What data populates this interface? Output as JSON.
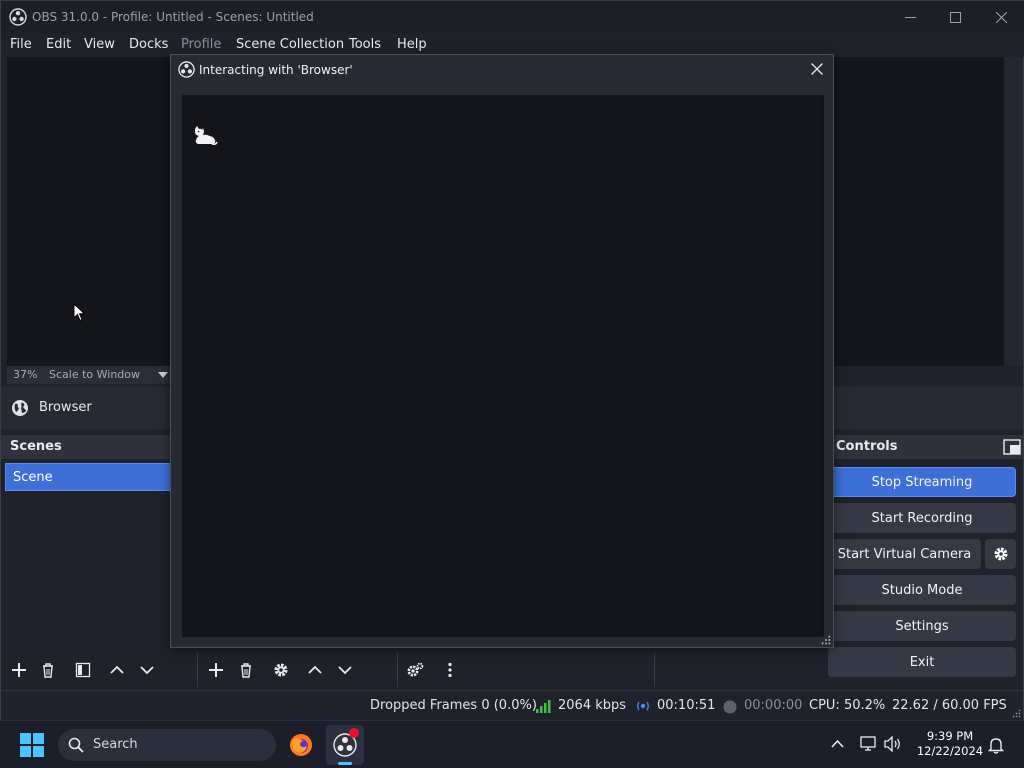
{
  "window": {
    "title": "OBS 31.0.0 - Profile: Untitled - Scenes: Untitled"
  },
  "menu": {
    "file": "File",
    "edit": "Edit",
    "view": "View",
    "docks": "Docks",
    "profile": "Profile",
    "scene_collection": "Scene Collection",
    "tools": "Tools",
    "help": "Help"
  },
  "preview": {
    "zoom": "37%",
    "scale_mode": "Scale to Window"
  },
  "source_toolbar": {
    "source_name": "Browser"
  },
  "scenes": {
    "header": "Scenes",
    "items": [
      {
        "label": "Scene"
      }
    ]
  },
  "controls": {
    "header": "Controls",
    "stop_streaming": "Stop Streaming",
    "start_recording": "Start Recording",
    "start_virtual_camera": "Start Virtual Camera",
    "studio_mode": "Studio Mode",
    "settings": "Settings",
    "exit": "Exit",
    "accent": "#3d6fd6"
  },
  "dialog": {
    "title": "Interacting with 'Browser'"
  },
  "status": {
    "dropped_frames": "Dropped Frames 0 (0.0%)",
    "bitrate": "2064 kbps",
    "stream_time": "00:10:51",
    "record_time": "00:00:00",
    "cpu": "CPU: 50.2%",
    "fps": "22.62 / 60.00 FPS",
    "bitrate_color": "#3cc23c"
  },
  "taskbar": {
    "search_placeholder": "Search",
    "time": "9:39 PM",
    "date": "12/22/2024",
    "pinned": [
      "start-icon",
      "firefox-icon",
      "obs-icon"
    ]
  }
}
